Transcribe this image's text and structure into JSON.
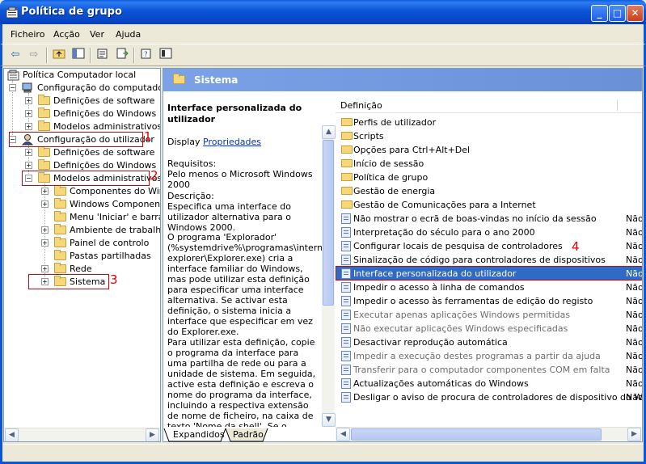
{
  "window": {
    "title": "Política de grupo",
    "controls": {
      "minimize": "_",
      "maximize": "□",
      "close": "✕"
    }
  },
  "menu": [
    "Ficheiro",
    "Acção",
    "Ver",
    "Ajuda"
  ],
  "toolbar_icons": [
    "back-arrow-icon",
    "forward-arrow-icon",
    "up-folder-icon",
    "show-hide-tree-icon",
    "properties-icon",
    "export-list-icon",
    "help-icon",
    "console-tree-icon"
  ],
  "tree": {
    "root": "Política Computador local",
    "items": [
      "Configuração do computador",
      "Definições de software",
      "Definições do Windows",
      "Modelos administrativos",
      "Configuração do utilizador",
      "Definições de software",
      "Definições do Windows",
      "Modelos administrativos",
      "Componentes do Windo",
      "Windows Components",
      "Menu 'Iniciar' e barra d",
      "Ambiente de trabalho",
      "Painel de controlo",
      "Pastas partilhadas",
      "Rede",
      "Sistema"
    ]
  },
  "annotations": [
    "1",
    "2",
    "3",
    "4"
  ],
  "header": {
    "title": "Sistema"
  },
  "description": {
    "title": "Interface personalizada do utilizador",
    "display_label": "Display",
    "display_link": "Propriedades",
    "requirements_label": "Requisitos:",
    "requirements_text": "Pelo menos o Microsoft Windows 2000",
    "description_label": "Descrição:",
    "description_text": "Especifica uma interface do utilizador alternativa para o Windows 2000.",
    "para1": "O programa 'Explorador' (%systemdrive%\\programas\\internet explorer\\Explorer.exe) cria a interface familiar do Windows, mas pode utilizar esta definição para especificar uma interface alternativa. Se activar esta definição, o sistema inicia a interface que especificar em vez do Explorer.exe.",
    "para2": "Para utilizar esta definição, copie o programa da interface para uma partilha de rede ou para a unidade de sistema. Em seguida, active esta definição e escreva o nome do programa da interface, incluindo a respectiva extensão de nome de ficheiro, na caixa de texto 'Nome da shell'. Se o programa da interface não"
  },
  "list": {
    "column_header": "Definição",
    "rows": [
      {
        "name": "Perfis de utilizador",
        "kind": "folder",
        "value": ""
      },
      {
        "name": "Scripts",
        "kind": "folder",
        "value": ""
      },
      {
        "name": "Opções para Ctrl+Alt+Del",
        "kind": "folder",
        "value": ""
      },
      {
        "name": "Início de sessão",
        "kind": "folder",
        "value": ""
      },
      {
        "name": "Política de grupo",
        "kind": "folder",
        "value": ""
      },
      {
        "name": "Gestão de energia",
        "kind": "folder",
        "value": ""
      },
      {
        "name": "Gestão de Comunicações para a Internet",
        "kind": "folder",
        "value": ""
      },
      {
        "name": "Não mostrar o ecrã de boas-vindas no início da sessão",
        "kind": "policy",
        "value": "Não"
      },
      {
        "name": "Interpretação do século para o ano 2000",
        "kind": "policy",
        "value": "Não"
      },
      {
        "name": "Configurar locais de pesquisa de controladores",
        "kind": "policy",
        "value": "Não"
      },
      {
        "name": "Sinalização de código para controladores de dispositivos",
        "kind": "policy",
        "value": "Não"
      },
      {
        "name": "Interface personalizada do utilizador",
        "kind": "policy",
        "value": "Não",
        "selected": true
      },
      {
        "name": "Impedir o acesso à linha de comandos",
        "kind": "policy",
        "value": "Não"
      },
      {
        "name": "Impedir o acesso às ferramentas de edição do registo",
        "kind": "policy",
        "value": "Não"
      },
      {
        "name": "Executar apenas aplicações Windows permitidas",
        "kind": "policy",
        "value": "Não",
        "dim": true
      },
      {
        "name": "Não executar aplicações Windows especificadas",
        "kind": "policy",
        "value": "Não",
        "dim": true
      },
      {
        "name": "Desactivar reprodução automática",
        "kind": "policy",
        "value": "Não"
      },
      {
        "name": "Impedir a execução destes programas a partir da ajuda",
        "kind": "policy",
        "value": "Não",
        "dim": true
      },
      {
        "name": "Transferir para o computador componentes COM em falta",
        "kind": "policy",
        "value": "Não",
        "dim": true
      },
      {
        "name": "Actualizações automáticas do Windows",
        "kind": "policy",
        "value": "Não"
      },
      {
        "name": "Desligar o aviso de procura de controladores de dispositivo do Wi...",
        "kind": "policy",
        "value": "Não"
      }
    ]
  },
  "tabs": [
    "Expandidos",
    "Padrão"
  ],
  "colors": {
    "titlebar": "#0a55d8",
    "header": "#7ba2e7",
    "selection": "#316ac5",
    "annotation": "#e00000"
  }
}
